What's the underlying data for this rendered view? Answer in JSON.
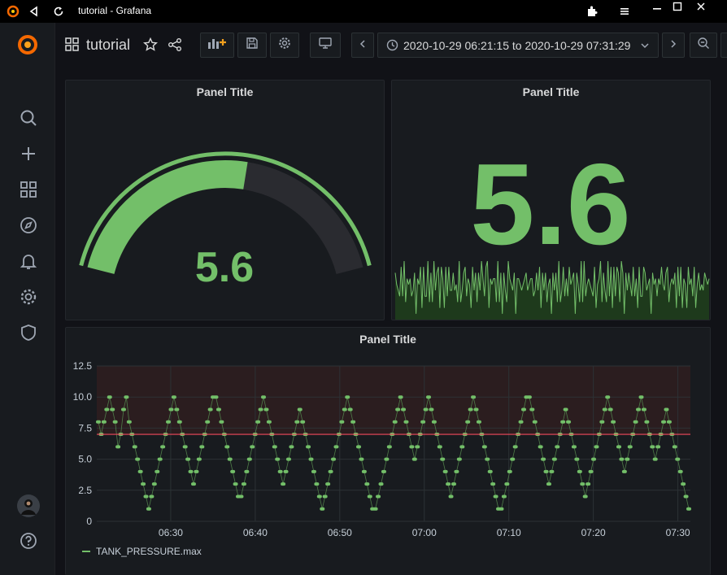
{
  "window": {
    "title": "tutorial - Grafana"
  },
  "header": {
    "dashboard_title": "tutorial",
    "time_range": "2020-10-29 06:21:15 to 2020-10-29 07:31:29"
  },
  "colors": {
    "accent_green": "#73bf69",
    "threshold_red": "#f2495c",
    "background": "#111217",
    "panel": "#181b1f"
  },
  "icons": {
    "sidebar": [
      "grafana-logo-icon",
      "search-icon",
      "plus-icon",
      "dashboards-grid-icon",
      "explore-compass-icon",
      "alerting-bell-icon",
      "configuration-gear-icon",
      "server-admin-shield-icon",
      "user-avatar",
      "help-icon"
    ],
    "toolbar": [
      "add-panel-icon",
      "save-icon",
      "settings-icon",
      "tv-mode-icon",
      "time-back-icon",
      "clock-icon",
      "chevron-down-icon",
      "time-forward-icon",
      "zoom-out-icon"
    ]
  },
  "panels": {
    "gauge": {
      "title": "Panel Title",
      "value": "5.6",
      "fraction": 0.56
    },
    "stat": {
      "title": "Panel Title",
      "value": "5.6"
    },
    "graph": {
      "title": "Panel Title",
      "legend": "TANK_PRESSURE.max"
    }
  },
  "chart_data": {
    "type": "line",
    "y_ticks": [
      "12.5",
      "10.0",
      "7.5",
      "5.0",
      "2.5",
      "0"
    ],
    "ylim": [
      0,
      12.5
    ],
    "x_ticks": [
      "06:30",
      "06:40",
      "06:50",
      "07:00",
      "07:10",
      "07:20",
      "07:30"
    ],
    "threshold": 7,
    "grid": true,
    "legend": "bottom-left",
    "series": [
      {
        "name": "TANK_PRESSURE.max",
        "x_range": [
          "06:21:15",
          "07:31:29"
        ],
        "values": [
          8,
          7,
          8,
          9,
          10,
          9,
          8,
          6,
          7,
          9,
          10,
          8,
          7,
          6,
          5,
          4,
          3,
          2,
          1,
          2,
          3,
          4,
          5,
          6,
          7,
          8,
          9,
          10,
          9,
          8,
          7,
          6,
          5,
          4,
          3,
          4,
          5,
          6,
          7,
          8,
          9,
          10,
          10,
          9,
          8,
          7,
          6,
          5,
          4,
          3,
          2,
          2,
          3,
          4,
          5,
          6,
          7,
          8,
          9,
          10,
          9,
          8,
          7,
          6,
          5,
          4,
          3,
          4,
          5,
          6,
          7,
          8,
          9,
          8,
          7,
          6,
          5,
          4,
          3,
          2,
          1,
          2,
          3,
          4,
          5,
          6,
          7,
          8,
          9,
          10,
          9,
          8,
          7,
          6,
          5,
          4,
          3,
          2,
          1,
          1,
          2,
          3,
          4,
          5,
          6,
          7,
          8,
          9,
          10,
          9,
          8,
          7,
          6,
          5,
          6,
          7,
          8,
          9,
          10,
          9,
          8,
          7,
          6,
          5,
          4,
          3,
          2,
          3,
          4,
          5,
          6,
          7,
          8,
          9,
          10,
          9,
          8,
          7,
          6,
          5,
          4,
          3,
          2,
          1,
          1,
          2,
          3,
          4,
          5,
          6,
          7,
          8,
          9,
          10,
          10,
          9,
          8,
          7,
          6,
          5,
          4,
          3,
          4,
          5,
          6,
          7,
          8,
          9,
          8,
          7,
          6,
          5,
          4,
          3,
          2,
          3,
          4,
          5,
          6,
          7,
          8,
          9,
          10,
          9,
          8,
          7,
          6,
          5,
          4,
          5,
          6,
          7,
          8,
          9,
          10,
          9,
          8,
          7,
          6,
          5,
          6,
          7,
          8,
          9,
          8,
          7,
          6,
          5,
          4,
          3,
          2,
          1
        ]
      }
    ]
  }
}
